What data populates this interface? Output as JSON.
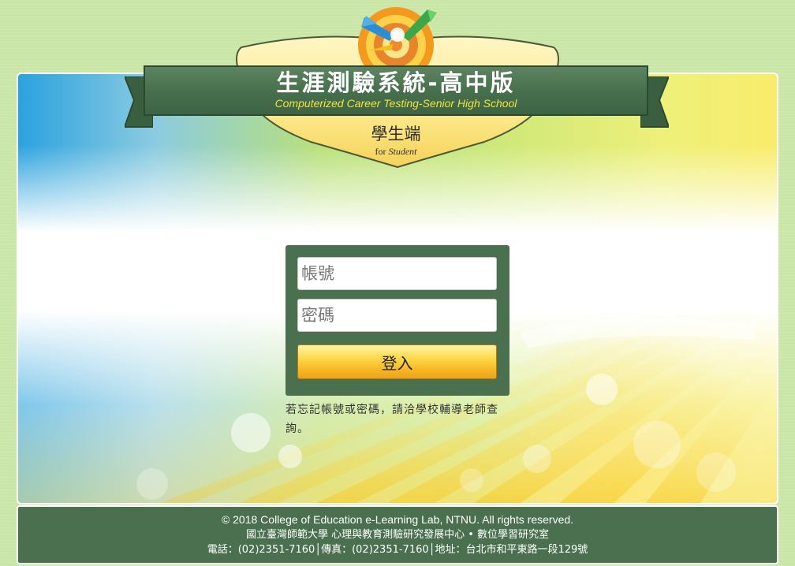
{
  "header": {
    "title": "生涯測驗系統-高中版",
    "subtitle": "Computerized Career Testing-Senior High School",
    "role": "學生端",
    "role_sub_for": "for",
    "role_sub_student": "Student"
  },
  "login": {
    "account_placeholder": "帳號",
    "password_placeholder": "密碼",
    "submit_label": "登入",
    "help_text": "若忘記帳號或密碼，請洽學校輔導老師查詢。"
  },
  "footer": {
    "copyright": "© 2018 College of Education e-Learning Lab, NTNU. All rights reserved.",
    "organization": "國立臺灣師範大學 心理與教育測驗研究發展中心 • 數位學習研究室",
    "contact": "電話：(02)2351-7160│傳真：(02)2351-7160│地址：台北市和平東路一段129號"
  },
  "colors": {
    "ribbon_green": "#47704d",
    "title_yellow": "#f2e43a",
    "button_orange": "#f6b623",
    "footer_green": "#4a7050"
  }
}
